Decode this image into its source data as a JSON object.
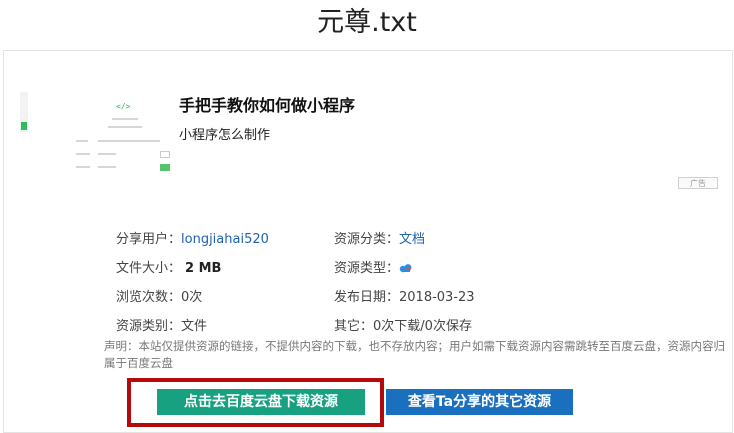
{
  "page": {
    "title": "元尊.txt"
  },
  "ad": {
    "thumb_code": "</>",
    "title": "手把手教你如何做小程序",
    "description": "小程序怎么制作",
    "badge": "广告"
  },
  "info": {
    "share_user_label": "分享用户：",
    "share_user_value": "longjiahai520",
    "category_label": "资源分类：",
    "category_value": "文档",
    "file_size_label": "文件大小：",
    "file_size_value": "2 MB",
    "resource_type_label": "资源类型：",
    "resource_type_icon": "baidu-cloud-icon",
    "views_label": "浏览次数：",
    "views_value": "0次",
    "publish_date_label": "发布日期：",
    "publish_date_value": "2018-03-23",
    "resource_kind_label": "资源类别：",
    "resource_kind_value": "文件",
    "other_label": "其它：",
    "other_value": "0次下载/0次保存"
  },
  "notice": "声明：本站仅提供资源的链接，不提供内容的下载，也不存放内容；用户如需下载资源内容需跳转至百度云盘，资源内容归属于百度云盘",
  "buttons": {
    "download": "点击去百度云盘下载资源",
    "other_shares": "查看Ta分享的其它资源"
  },
  "colors": {
    "download_button": "#17a180",
    "other_button": "#1b6fbf",
    "highlight_frame": "#b50a0a",
    "link": "#1f62b0"
  }
}
